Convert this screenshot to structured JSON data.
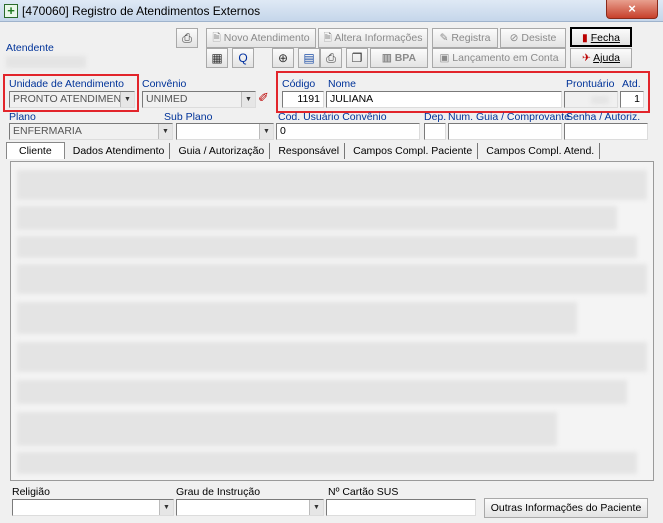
{
  "window": {
    "title": "[470060]  Registro de Atendimentos Externos",
    "close_glyph": "×"
  },
  "toolbar": {
    "novo_atendimento": "Novo Atendimento",
    "altera_informacoes": "Altera Informações",
    "registra": "Registra",
    "desiste": "Desiste",
    "fecha": "Fecha",
    "bpa": "BPA",
    "lancamento_conta": "Lançamento em Conta",
    "ajuda": "Ajuda"
  },
  "header": {
    "atendente_label": "Atendente",
    "unidade_label": "Unidade de Atendimento",
    "unidade_value": "PRONTO ATENDIMENT",
    "convenio_label": "Convênio",
    "convenio_value": "UNIMED",
    "codigo_label": "Código",
    "codigo_value": "1191",
    "nome_label": "Nome",
    "nome_value": "JULIANA",
    "prontuario_label": "Prontuário",
    "atd_label": "Atd.",
    "atd_value": "1",
    "plano_label": "Plano",
    "plano_value": "ENFERMARIA",
    "subplano_label": "Sub Plano",
    "cod_usuario_label": "Cod. Usuário Convênio",
    "cod_usuario_value": "0",
    "dep_label": "Dep.",
    "guia_label": "Num. Guia / Comprovante",
    "senha_label": "Senha / Autoriz."
  },
  "tabs": [
    "Cliente",
    "Dados Atendimento",
    "Guia / Autorização",
    "Responsável",
    "Campos Compl. Paciente",
    "Campos Compl. Atend."
  ],
  "footer": {
    "religiao_label": "Religião",
    "grau_label": "Grau de Instrução",
    "sus_label": "Nº Cartão SUS",
    "outras_button": "Outras Informações do Paciente"
  }
}
